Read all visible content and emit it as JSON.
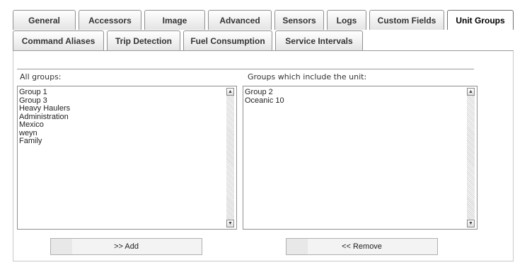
{
  "tabs_row1": [
    {
      "label": "General",
      "active": false
    },
    {
      "label": "Accessors",
      "active": false
    },
    {
      "label": "Image",
      "active": false
    },
    {
      "label": "Advanced",
      "active": false
    },
    {
      "label": "Sensors",
      "active": false
    },
    {
      "label": "Logs",
      "active": false
    },
    {
      "label": "Custom Fields",
      "active": false
    },
    {
      "label": "Unit Groups",
      "active": true
    }
  ],
  "tabs_row2": [
    {
      "label": "Command Aliases"
    },
    {
      "label": "Trip Detection"
    },
    {
      "label": "Fuel Consumption"
    },
    {
      "label": "Service Intervals"
    }
  ],
  "all_groups": {
    "label": "All groups:",
    "items": [
      "Group 1",
      "Group 3",
      "Heavy Haulers",
      "Administration",
      "Mexico",
      "weyn",
      "Family"
    ]
  },
  "unit_groups": {
    "label": "Groups which include the unit:",
    "items": [
      "Group 2",
      "Oceanic 10"
    ]
  },
  "buttons": {
    "add": ">> Add",
    "remove": "<< Remove"
  }
}
